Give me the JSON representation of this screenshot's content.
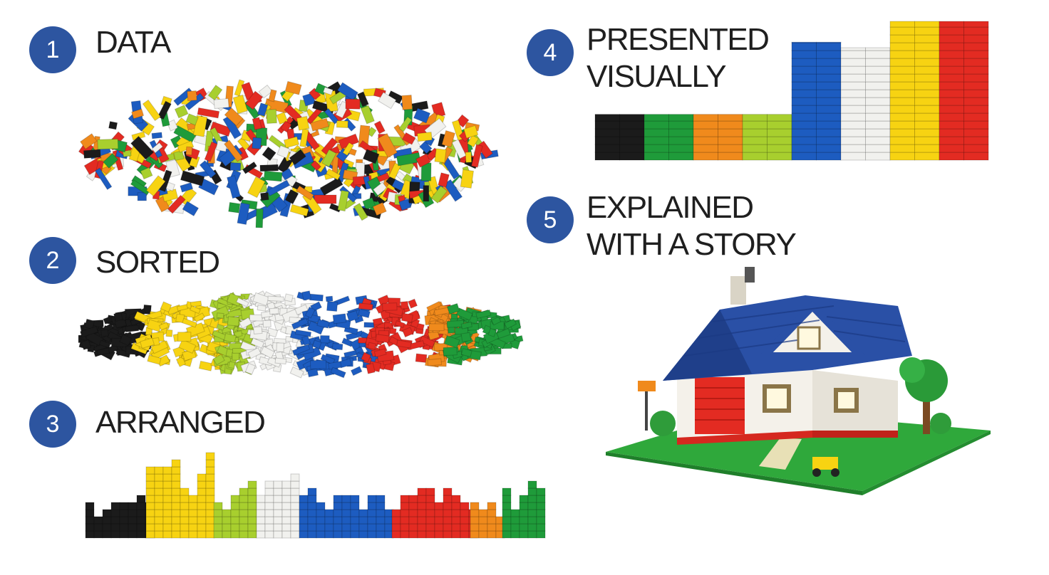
{
  "colors": {
    "badge": "#2d55a0",
    "black": "#1b1b1b",
    "green": "#1f9b3a",
    "orange": "#f08a1c",
    "lime": "#a8cf2e",
    "blue": "#1d5cc0",
    "white": "#f1f1ee",
    "yellow": "#f7d312",
    "red": "#e32b22"
  },
  "steps": [
    {
      "number": "1",
      "title": "DATA"
    },
    {
      "number": "2",
      "title": "SORTED"
    },
    {
      "number": "3",
      "title": "ARRANGED"
    },
    {
      "number": "4",
      "title": "PRESENTED VISUALLY"
    },
    {
      "number": "5",
      "title": "EXPLAINED WITH A STORY"
    }
  ],
  "illustrations": {
    "data": "pile of mixed colored bricks",
    "sorted": "bricks sorted into color groups",
    "arranged": "bricks arranged in stacks by color",
    "presented": "stacked brick bar chart by color",
    "story": "brick-built house with blue roof and green lawn"
  },
  "presented_stack_order": [
    "black",
    "green",
    "orange",
    "lime",
    "blue",
    "white",
    "yellow",
    "red"
  ],
  "presented_stack_levels": [
    0.33,
    0.33,
    0.33,
    0.33,
    0.85,
    0.81,
    1.0,
    1.0
  ]
}
